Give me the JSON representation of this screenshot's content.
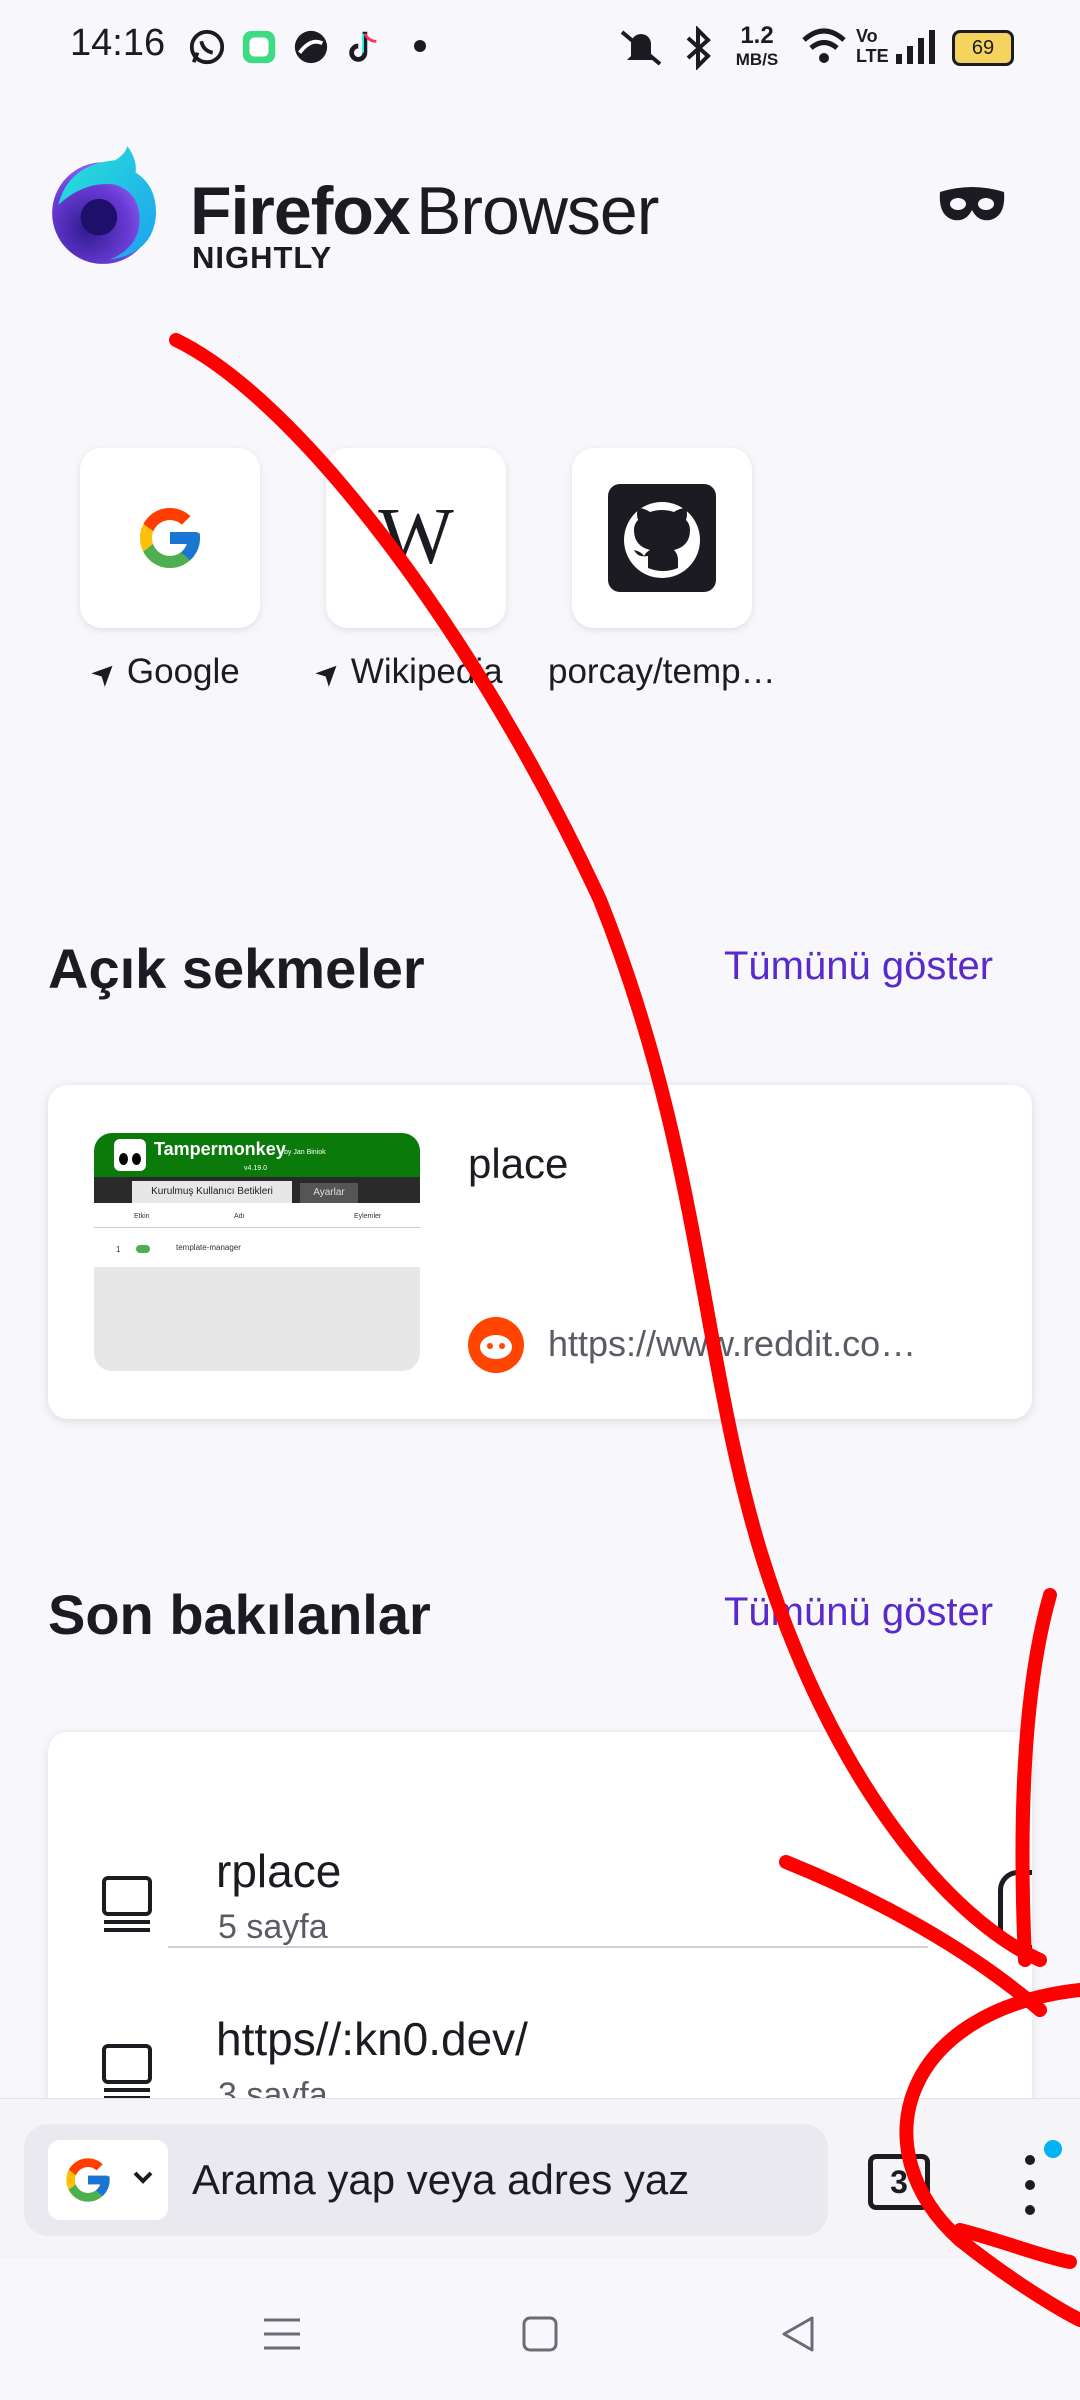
{
  "status_bar": {
    "time": "14:16",
    "app_icons": [
      "whatsapp-icon",
      "messages-icon",
      "app-icon",
      "tiktok-icon"
    ],
    "network_speed_value": "1.2",
    "network_speed_unit": "MB/S",
    "volte": "Vo LTE",
    "battery": "69"
  },
  "header": {
    "brand_firefox": "Firefox",
    "brand_browser": "Browser",
    "brand_nightly": "NIGHTLY",
    "private_icon": "mask-icon"
  },
  "shortcuts": [
    {
      "label": "Google",
      "pinned": true,
      "icon": "google-icon"
    },
    {
      "label": "Wikipedia",
      "pinned": true,
      "icon": "wikipedia-icon"
    },
    {
      "label": "porcay/temp…",
      "pinned": false,
      "icon": "github-icon"
    }
  ],
  "open_tabs": {
    "title": "Açık sekmeler",
    "show_all": "Tümünü göster",
    "tab": {
      "title": "place",
      "url": "https://www.reddit.co…",
      "thumbnail": {
        "brand": "Tampermonkey",
        "by": "by Jan Biniok",
        "version": "v4.19.0",
        "tab_installed": "Kurulmuş Kullanıcı Betikleri",
        "tab_settings": "Ayarlar",
        "col_enabled": "Etkin",
        "col_name": "Adı",
        "col_actions": "Eylemler",
        "row_num": "1",
        "row_name": "template-manager"
      }
    }
  },
  "recent": {
    "title": "Son bakılanlar",
    "show_all": "Tümünü göster",
    "items": [
      {
        "title": "rplace",
        "subtitle": "5 sayfa"
      },
      {
        "title": "https//:kn0.dev/",
        "subtitle": "3 sayfa"
      }
    ]
  },
  "toolbar": {
    "search_placeholder": "Arama yap veya adres yaz",
    "tab_count": "3"
  },
  "colors": {
    "accent_link": "#592acb",
    "scribble": "#ff0000",
    "reddit": "#ff4500",
    "notification_dot": "#00b3f4"
  }
}
